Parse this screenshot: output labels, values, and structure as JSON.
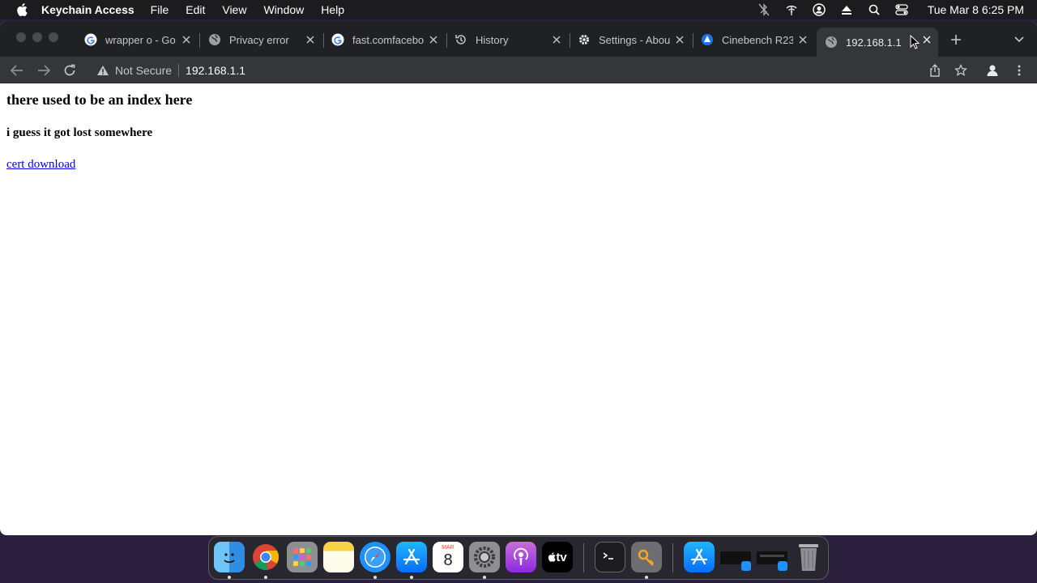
{
  "menubar": {
    "app_name": "Keychain Access",
    "items": [
      "File",
      "Edit",
      "View",
      "Window",
      "Help"
    ],
    "clock": "Tue Mar 8  6:25 PM"
  },
  "tabs": [
    {
      "title": "wrapper o - Go",
      "favicon": "google-icon"
    },
    {
      "title": "Privacy error",
      "favicon": "globe-icon"
    },
    {
      "title": "fast.comfacebo",
      "favicon": "google-icon"
    },
    {
      "title": "History",
      "favicon": "history-icon"
    },
    {
      "title": "Settings - Abou",
      "favicon": "settings-gear-icon"
    },
    {
      "title": "Cinebench R23",
      "favicon": "cinebench-icon"
    },
    {
      "title": "192.168.1.1",
      "favicon": "globe-icon",
      "active": true
    }
  ],
  "omnibox": {
    "security_label": "Not Secure",
    "url": "192.168.1.1"
  },
  "page": {
    "heading": "there used to be an index here",
    "subheading": "i guess it got lost somewhere",
    "link": "cert download"
  },
  "dock": {
    "calendar_month": "MAR",
    "calendar_day": "8",
    "tv_label": "tv"
  },
  "colors": {
    "link": "#0000ee",
    "tabstrip": "#202124",
    "toolbar": "#35363a"
  }
}
